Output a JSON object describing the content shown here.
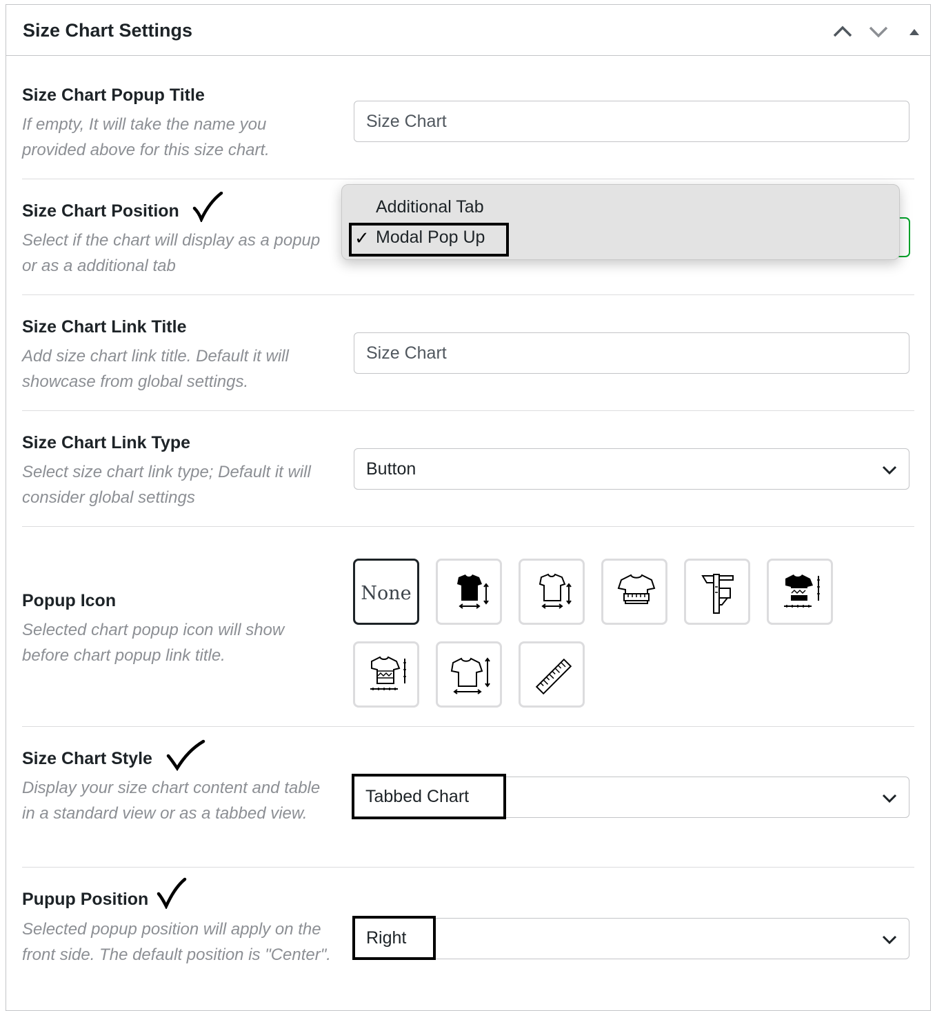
{
  "panel": {
    "title": "Size Chart Settings"
  },
  "fields": {
    "popup_title": {
      "label": "Size Chart Popup Title",
      "description": "If empty, It will take the name you provided above for this size chart.",
      "placeholder": "Size Chart"
    },
    "position": {
      "label": "Size Chart Position",
      "description": "Select if the chart will display as a popup or as a additional tab",
      "options": [
        "Additional Tab",
        "Modal Pop Up"
      ],
      "selected": "Modal Pop Up"
    },
    "link_title": {
      "label": "Size Chart Link Title",
      "description": "Add size chart link title. Default it will showcase from global settings.",
      "placeholder": "Size Chart"
    },
    "link_type": {
      "label": "Size Chart Link Type",
      "description": "Select size chart link type; Default it will consider global settings",
      "value": "Button"
    },
    "popup_icon": {
      "label": "Popup Icon",
      "description": "Selected chart popup icon will show before chart popup link title.",
      "none_label": "None",
      "icons": [
        "tshirt-solid-measure-icon",
        "tshirt-outline-measure-icon",
        "tshirt-tape-icon",
        "caliper-icon",
        "tshirt-pattern-ruler-icon",
        "tshirt-pattern-outline-ruler-icon",
        "tshirt-arrows-icon",
        "ruler-icon"
      ],
      "selected": "None"
    },
    "chart_style": {
      "label": "Size Chart Style",
      "description": "Display your size chart content and table in a standard view or as a tabbed view.",
      "value": "Tabbed Chart"
    },
    "popup_position": {
      "label": "Pupup Position",
      "description": "Selected popup position will apply on the front side. The default position is \"Center\".",
      "value": "Right"
    }
  },
  "check_mark": "✓"
}
